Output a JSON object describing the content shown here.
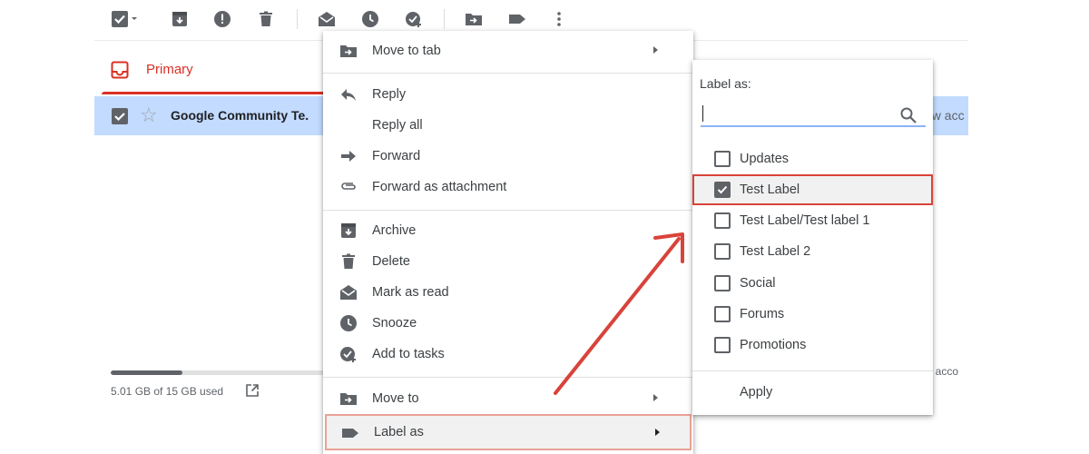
{
  "toolbar": {
    "icons": [
      "select-checkbox-icon",
      "archive-icon",
      "report-spam-icon",
      "delete-icon",
      "mark-read-icon",
      "snooze-icon",
      "add-to-tasks-icon",
      "move-to-icon",
      "label-icon",
      "more-icon"
    ]
  },
  "inbox": {
    "primary_tab_label": "Primary",
    "email": {
      "sender": "Google Community Te.",
      "snippet_fragment": "ew acc"
    }
  },
  "storage": {
    "text": "5.01 GB of 15 GB used",
    "used_fraction": 0.334
  },
  "footer": {
    "account_fragment": "st acco"
  },
  "context_menu": {
    "move_to_tab": "Move to tab",
    "reply": "Reply",
    "reply_all": "Reply all",
    "forward": "Forward",
    "forward_as_attachment": "Forward as attachment",
    "archive": "Archive",
    "delete": "Delete",
    "mark_as_read": "Mark as read",
    "snooze": "Snooze",
    "add_to_tasks": "Add to tasks",
    "move_to": "Move to",
    "label_as": "Label as"
  },
  "label_submenu": {
    "title": "Label as:",
    "search_value": "",
    "labels": [
      {
        "name": "Updates",
        "checked": false
      },
      {
        "name": "Test Label",
        "checked": true
      },
      {
        "name": "Test Label/Test label 1",
        "checked": false
      },
      {
        "name": "Test Label 2",
        "checked": false
      },
      {
        "name": "Social",
        "checked": false
      },
      {
        "name": "Forums",
        "checked": false
      },
      {
        "name": "Promotions",
        "checked": false
      }
    ],
    "apply": "Apply"
  },
  "colors": {
    "accent_red": "#d93025",
    "selected_row": "#c2dbff",
    "annotation_red": "#d9433a",
    "icon_gray": "#5f6368"
  }
}
